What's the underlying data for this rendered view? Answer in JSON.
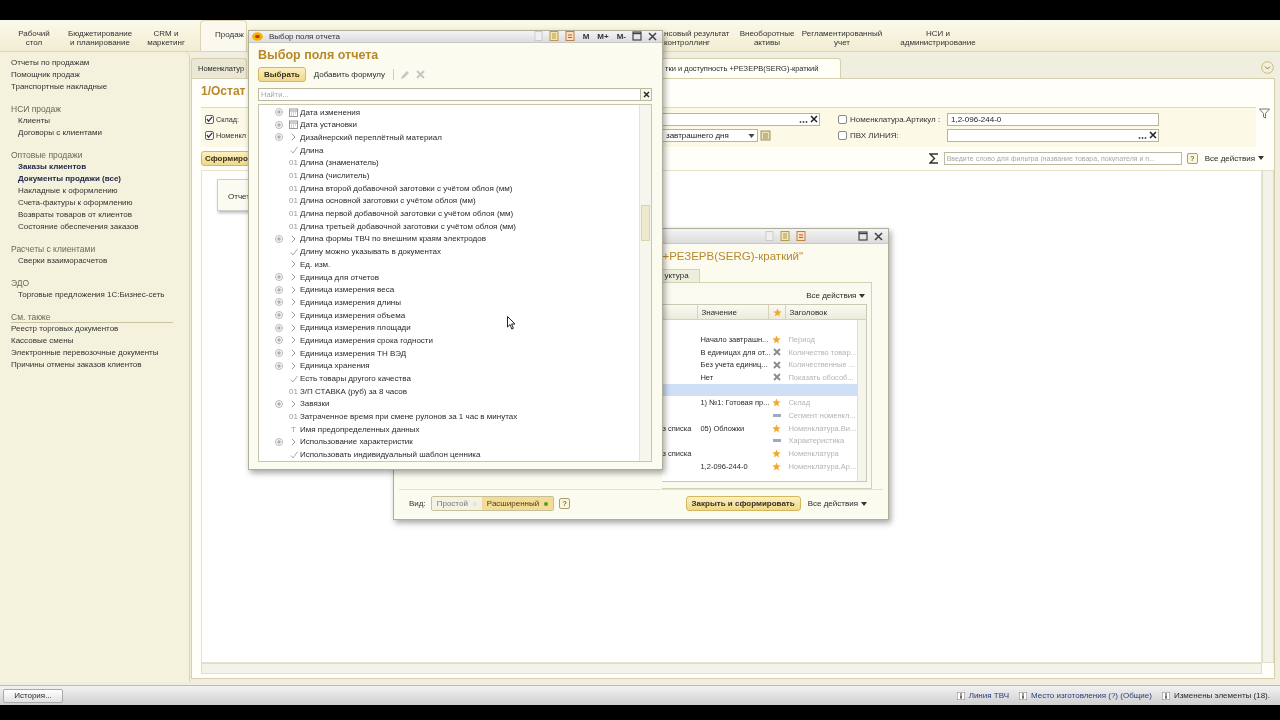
{
  "sections_left": [
    {
      "label": "Рабочий\nстол",
      "selected": false
    },
    {
      "label": "Бюджетирование\nи планирование",
      "selected": false
    },
    {
      "label": "CRM и\nмаркетинг",
      "selected": false
    },
    {
      "label": "Продаж",
      "selected": true
    }
  ],
  "sections_right": [
    {
      "label": "нсовый результат\nконтроллинг",
      "selected": false
    },
    {
      "label": "Внеоборотные\nактивы",
      "selected": false
    },
    {
      "label": "Регламентированный\nучет",
      "selected": false
    },
    {
      "label": "НСИ и\nадминистрирование",
      "selected": false
    }
  ],
  "sidebar": {
    "groups": [
      {
        "indented": false,
        "items": [
          {
            "label": "Отчеты по продажам",
            "bold": false
          },
          {
            "label": "Помощник продаж",
            "bold": false
          },
          {
            "label": "Транспортные накладные",
            "bold": false
          }
        ]
      },
      {
        "title": "НСИ продаж",
        "indented": true,
        "items": [
          {
            "label": "Клиенты",
            "bold": false
          },
          {
            "label": "Договоры с клиентами",
            "bold": false
          }
        ]
      },
      {
        "title": "Оптовые продажи",
        "indented": true,
        "items": [
          {
            "label": "Заказы клиентов",
            "bold": true
          },
          {
            "label": "Документы продажи (все)",
            "bold": true
          },
          {
            "label": "Накладные к оформлению",
            "bold": false
          },
          {
            "label": "Счета-фактуры к оформлению",
            "bold": false
          },
          {
            "label": "Возвраты товаров от клиентов",
            "bold": false
          },
          {
            "label": "Состояние обеспечения заказов",
            "bold": false
          }
        ]
      },
      {
        "title": "Расчеты с клиентами",
        "indented": true,
        "items": [
          {
            "label": "Сверки взаиморасчетов",
            "bold": false
          }
        ]
      },
      {
        "title": "ЭДО",
        "indented": true,
        "items": [
          {
            "label": "Торговые предложения 1С:Бизнес-сеть",
            "bold": false
          }
        ]
      },
      {
        "title": "См. также",
        "indented": false,
        "items": [
          {
            "label": "Реестр торговых документов",
            "bold": false
          },
          {
            "label": "Кассовые смены",
            "bold": false
          },
          {
            "label": "Электронные перевозочные документы",
            "bold": false
          },
          {
            "label": "Причины отмены заказов клиентов",
            "bold": false
          }
        ]
      }
    ]
  },
  "tabs": [
    {
      "label": "Номенклатур",
      "selected": false
    },
    {
      "label": "тки и доступность +РЕЗЕРВ(SERG)-краткий",
      "selected": true
    }
  ],
  "report": {
    "title": "1/Остат",
    "filters": [
      {
        "checked": true,
        "label": "Склад:",
        "field": {
          "kind": "select"
        },
        "right": {
          "checked": false,
          "label": "Номенклатура.Артикул :",
          "kind": "text",
          "value": "1,2-096-244-0"
        }
      },
      {
        "checked": true,
        "label": "Номенкл",
        "field": {
          "kind": "period",
          "value": "завтрашнего дня"
        },
        "right": {
          "checked": false,
          "label": "ПВХ ЛИНИЯ:",
          "kind": "select"
        }
      }
    ],
    "generate_button": "Сформиро",
    "search_placeholder": "Введите слово для фильтра (название товара, покупателя и п...",
    "help": "?",
    "all_actions": "Все действия",
    "popup": "Отчет"
  },
  "status": {
    "history_button": "История...",
    "items": [
      "Линия ТВЧ",
      "Место изготовления (?) (Общие)",
      "Изменены элементы (18)."
    ]
  },
  "field_dialog": {
    "window_title": "Выбор поля отчета",
    "memory_buttons": [
      "M",
      "M+",
      "M-"
    ],
    "heading": "Выбор поля отчета",
    "select_button": "Выбрать",
    "add_formula": "Добавить формулу",
    "search_placeholder": "Найти...",
    "fields": [
      {
        "name": "Дата изменения",
        "expandable": true,
        "kind": "date"
      },
      {
        "name": "Дата установки",
        "expandable": true,
        "kind": "date"
      },
      {
        "name": "Дизайнерский переплётный материал",
        "expandable": true,
        "kind": "ref"
      },
      {
        "name": "Длина",
        "expandable": false,
        "kind": "bool"
      },
      {
        "name": "Длина (знаменатель)",
        "expandable": false,
        "kind": "number",
        "glyph": "01"
      },
      {
        "name": "Длина (числитель)",
        "expandable": false,
        "kind": "number",
        "glyph": "01"
      },
      {
        "name": "Длина второй добавочной заготовки с учётом облоя (мм)",
        "expandable": false,
        "kind": "number",
        "glyph": "01"
      },
      {
        "name": "Длина основной заготовки с учётом облоя (мм)",
        "expandable": false,
        "kind": "number",
        "glyph": "01"
      },
      {
        "name": "Длина первой добавочной заготовки с учётом облоя (мм)",
        "expandable": false,
        "kind": "number",
        "glyph": "01"
      },
      {
        "name": "Длина третьей добавочной заготовки с учётом облоя (мм)",
        "expandable": false,
        "kind": "number",
        "glyph": "01"
      },
      {
        "name": "Длина формы ТВЧ по внешним краям электродов",
        "expandable": true,
        "kind": "ref"
      },
      {
        "name": "Длину можно указывать в документах",
        "expandable": false,
        "kind": "bool"
      },
      {
        "name": "Ед. изм.",
        "expandable": false,
        "kind": "ref"
      },
      {
        "name": "Единица для отчетов",
        "expandable": true,
        "kind": "ref"
      },
      {
        "name": "Единица измерения веса",
        "expandable": true,
        "kind": "ref"
      },
      {
        "name": "Единица измерения длины",
        "expandable": true,
        "kind": "ref"
      },
      {
        "name": "Единица измерения объема",
        "expandable": true,
        "kind": "ref"
      },
      {
        "name": "Единица измерения площади",
        "expandable": true,
        "kind": "ref"
      },
      {
        "name": "Единица измерения срока годности",
        "expandable": true,
        "kind": "ref"
      },
      {
        "name": "Единица измерения ТН ВЭД",
        "expandable": true,
        "kind": "ref"
      },
      {
        "name": "Единица хранения",
        "expandable": true,
        "kind": "ref"
      },
      {
        "name": "Есть товары другого качества",
        "expandable": false,
        "kind": "bool"
      },
      {
        "name": "З/П СТАВКА (руб) за 8 часов",
        "expandable": false,
        "kind": "number",
        "glyph": "01"
      },
      {
        "name": "Завязки",
        "expandable": true,
        "kind": "ref"
      },
      {
        "name": "Затраченное время при смене рулонов за 1 час в минутах",
        "expandable": false,
        "kind": "number",
        "glyph": "01"
      },
      {
        "name": "Имя предопределенных данных",
        "expandable": false,
        "kind": "string",
        "glyph": "T"
      },
      {
        "name": "Использование характеристик",
        "expandable": true,
        "kind": "ref"
      },
      {
        "name": "Использовать индивидуальный шаблон ценника",
        "expandable": false,
        "kind": "bool"
      }
    ]
  },
  "settings_dialog": {
    "heading": "+РЕЗЕРВ(SERG)-краткий\"",
    "tab": "уктура",
    "all_actions": "Все действия",
    "columns": [
      "Значение",
      "Заголовок"
    ],
    "rows": [
      {
        "value": "Начало завтрашн...",
        "kind": "star",
        "title": "Период",
        "selected": false
      },
      {
        "value": "В единицах для от...",
        "kind": "cross",
        "title": "Количество товар...",
        "selected": false
      },
      {
        "value": "Без учета единиц...",
        "kind": "cross",
        "title": "Количественные ...",
        "selected": false
      },
      {
        "value": "Нет",
        "kind": "cross",
        "title": "Показать обособ...",
        "selected": false
      },
      {
        "selected": true
      },
      {
        "value": "1) №1: Готовая пр...",
        "kind": "star",
        "title": "Склад",
        "selected": false
      },
      {
        "kind": "dash",
        "title": "Сегмент номенкл...",
        "selected": false
      },
      {
        "column_1": "з списка",
        "value": "05) Обложки",
        "kind": "star",
        "title": "Номенклатура.Ви...",
        "selected": false
      },
      {
        "kind": "dash",
        "title": "Характеристика",
        "selected": false
      },
      {
        "column_1": "з списка",
        "kind": "star",
        "title": "Номенклатура",
        "selected": false
      },
      {
        "value": "1,2-096-244-0",
        "kind": "star",
        "title": "Номенклатура.Ар...",
        "selected": false
      }
    ],
    "view_label": "Вид:",
    "view_options": [
      {
        "label": "Простой",
        "selected": false
      },
      {
        "label": "Расширенный",
        "selected": true
      }
    ],
    "help": "?",
    "close_button": "Закрыть и сформировать",
    "footer_actions": "Все действия"
  }
}
